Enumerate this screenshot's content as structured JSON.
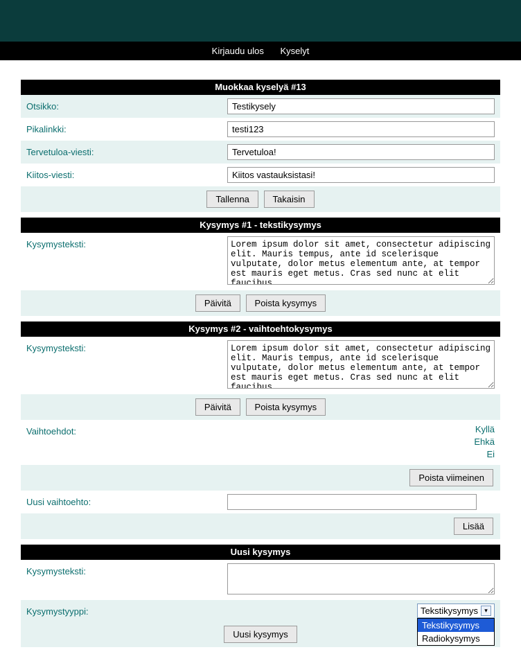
{
  "nav": {
    "logout": "Kirjaudu ulos",
    "surveys": "Kyselyt"
  },
  "editHeader": "Muokkaa kyselyä #13",
  "survey": {
    "titleLabel": "Otsikko:",
    "titleValue": "Testikysely",
    "slugLabel": "Pikalinkki:",
    "slugValue": "testi123",
    "welcomeLabel": "Tervetuloa-viesti:",
    "welcomeValue": "Tervetuloa!",
    "thanksLabel": "Kiitos-viesti:",
    "thanksValue": "Kiitos vastauksistasi!",
    "save": "Tallenna",
    "back": "Takaisin"
  },
  "q1": {
    "header": "Kysymys #1 - tekstikysymys",
    "textLabel": "Kysymysteksti:",
    "text": "Lorem ipsum dolor sit amet, consectetur adipiscing elit. Mauris tempus, ante id scelerisque vulputate, dolor metus elementum ante, at tempor est mauris eget metus. Cras sed nunc at elit faucibus",
    "update": "Päivitä",
    "delete": "Poista kysymys"
  },
  "q2": {
    "header": "Kysymys #2 - vaihtoehtokysymys",
    "textLabel": "Kysymysteksti:",
    "text": "Lorem ipsum dolor sit amet, consectetur adipiscing elit. Mauris tempus, ante id scelerisque vulputate, dolor metus elementum ante, at tempor est mauris eget metus. Cras sed nunc at elit faucibus",
    "update": "Päivitä",
    "delete": "Poista kysymys",
    "optionsLabel": "Vaihtoehdot:",
    "options": [
      "Kyllä",
      "Ehkä",
      "Ei"
    ],
    "removeLast": "Poista viimeinen",
    "newOptionLabel": "Uusi vaihtoehto:",
    "newOptionValue": "",
    "add": "Lisää"
  },
  "newQ": {
    "header": "Uusi kysymys",
    "textLabel": "Kysymysteksti:",
    "text": "",
    "typeLabel": "Kysymystyyppi:",
    "typeSelected": "Tekstikysymys",
    "typeOptions": [
      "Tekstikysymys",
      "Radiokysymys"
    ],
    "create": "Uusi kysymys"
  }
}
